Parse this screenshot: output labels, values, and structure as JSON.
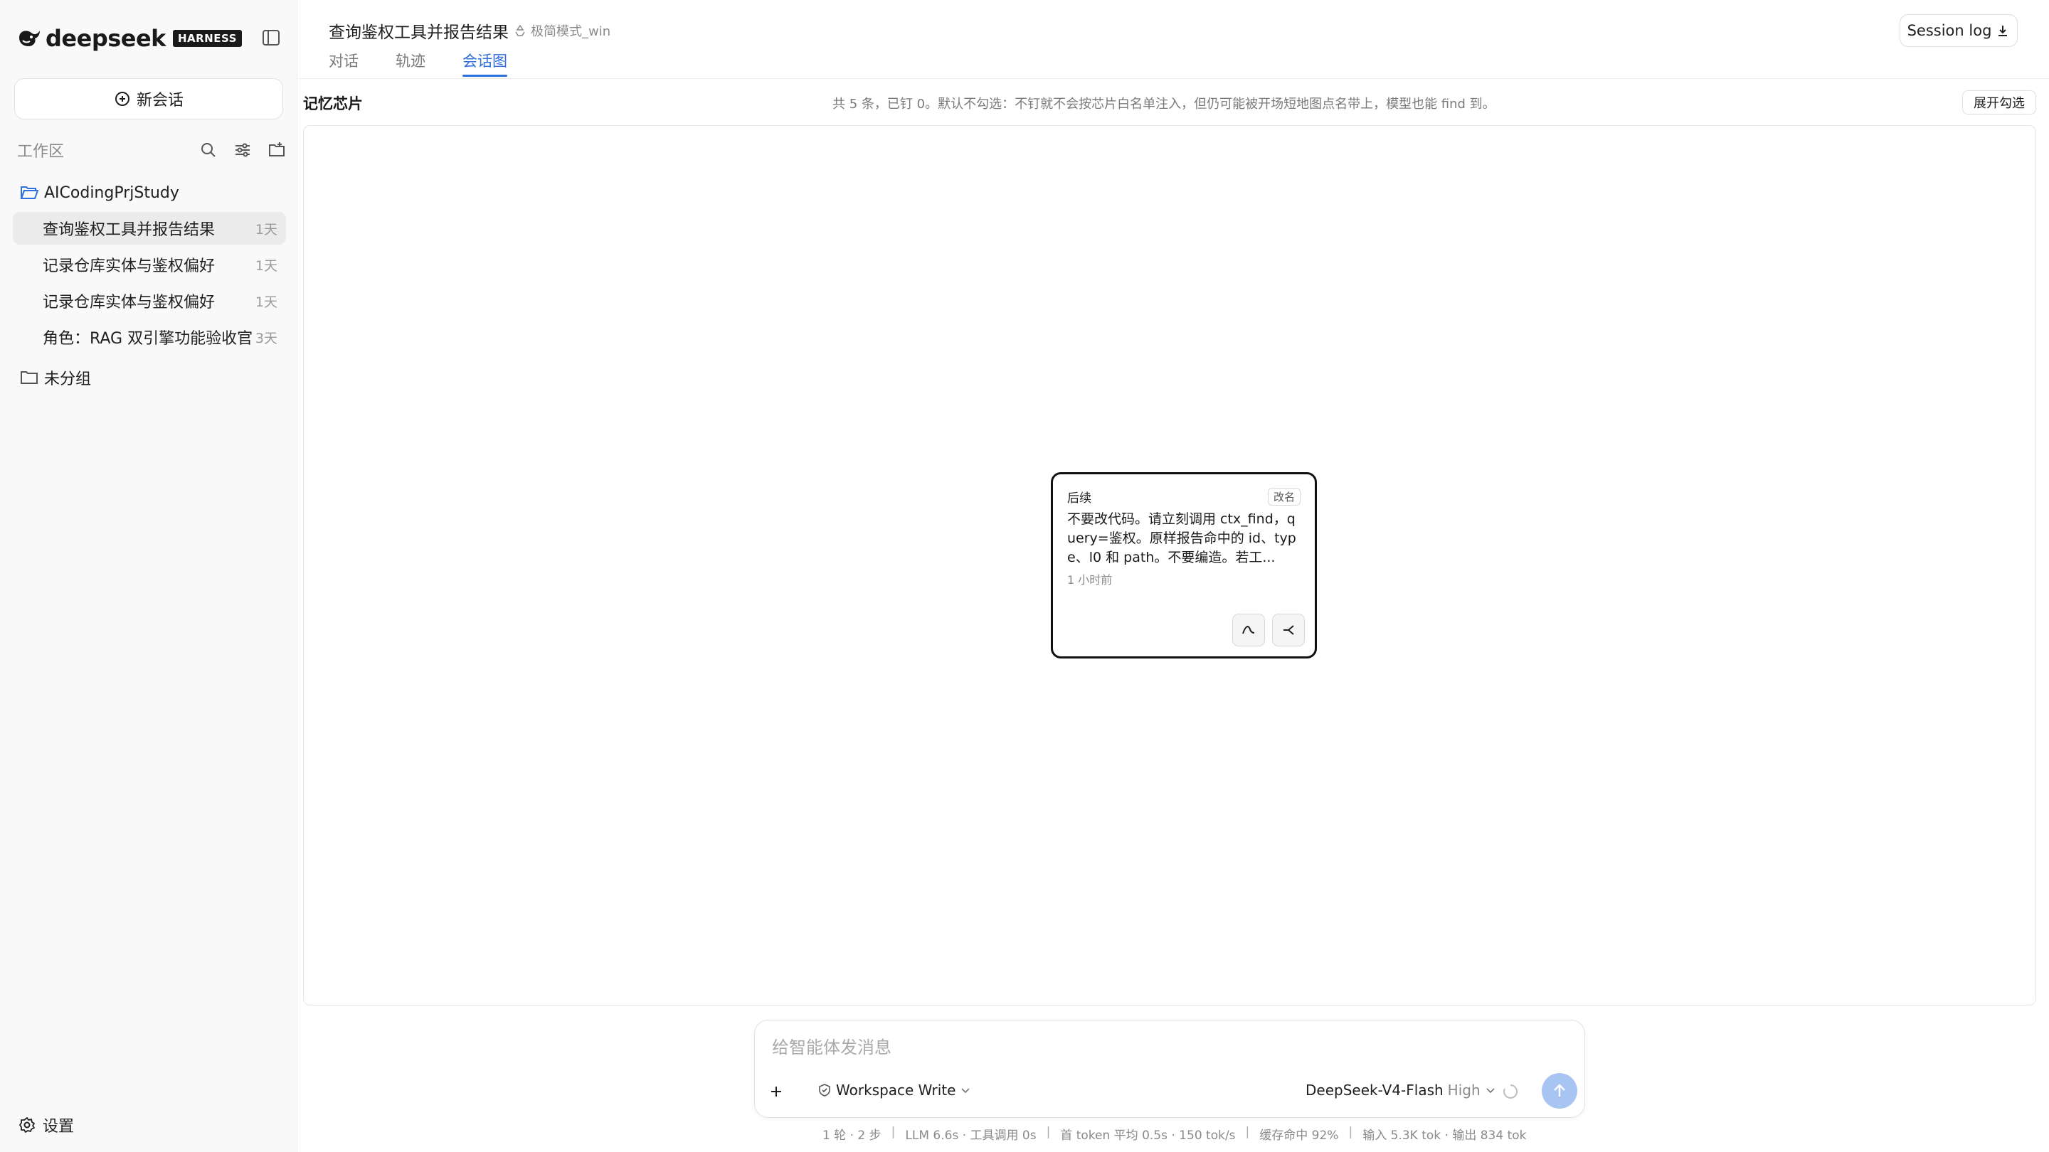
{
  "brand": {
    "name": "deepseek",
    "badge": "HARNESS"
  },
  "sidebar": {
    "new_chat_label": "新会话",
    "workspace_title": "工作区",
    "folders": [
      {
        "name": "AICodingPrjStudy"
      },
      {
        "name": "未分组"
      }
    ],
    "conversations": [
      {
        "title": "查询鉴权工具并报告结果",
        "age": "1天",
        "active": true
      },
      {
        "title": "记录仓库实体与鉴权偏好",
        "age": "1天",
        "active": false
      },
      {
        "title": "记录仓库实体与鉴权偏好",
        "age": "1天",
        "active": false
      },
      {
        "title": "角色：RAG 双引擎功能验收官",
        "age": "3天",
        "active": false
      }
    ],
    "settings_label": "设置"
  },
  "header": {
    "title": "查询鉴权工具并报告结果",
    "mode": "极简模式_win",
    "tabs": [
      {
        "label": "对话",
        "active": false
      },
      {
        "label": "轨迹",
        "active": false
      },
      {
        "label": "会话图",
        "active": true
      }
    ],
    "session_log_label": "Session log"
  },
  "memory": {
    "label": "记忆芯片",
    "info": "共 5 条，已钉 0。默认不勾选：不钉就不会按芯片白名单注入，但仍可能被开场短地图点名带上，模型也能 find 到。",
    "expand_label": "展开勾选"
  },
  "graph_node": {
    "label": "后续",
    "rename_label": "改名",
    "text": "不要改代码。请立刻调用 ctx_find，query=鉴权。原样报告命中的 id、type、l0 和 path。不要编造。若工...",
    "time": "1 小时前"
  },
  "composer": {
    "placeholder": "给智能体发消息",
    "permission": "Workspace Write",
    "model": "DeepSeek-V4-Flash",
    "effort": "High"
  },
  "status": {
    "turns": "1 轮 · 2 步",
    "llm": "LLM 6.6s · 工具调用 0s",
    "first_token": "首 token 平均 0.5s · 150 tok/s",
    "cache": "缓存命中 92%",
    "tokens": "输入 5.3K tok · 输出 834 tok"
  },
  "colors": {
    "accent": "#2f6fde",
    "send_button": "#a8c4f2",
    "sidebar_bg": "#f9f9f9"
  }
}
